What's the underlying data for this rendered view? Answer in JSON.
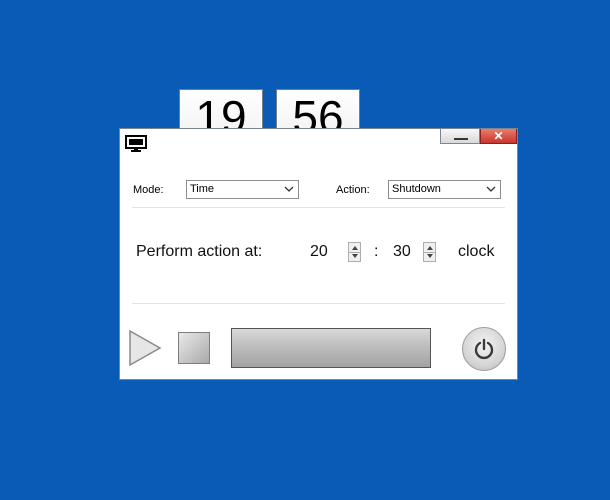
{
  "clock": {
    "hours": "19",
    "minutes": "56"
  },
  "window": {
    "controls": {
      "minimize_icon": "minimize-icon",
      "close_label": "✕"
    }
  },
  "mode": {
    "label": "Mode:",
    "value": "Time"
  },
  "action": {
    "label": "Action:",
    "value": "Shutdown"
  },
  "schedule": {
    "label": "Perform action at:",
    "hour": "20",
    "separator": ":",
    "minute": "30",
    "suffix": "clock"
  },
  "controls": {
    "play_icon": "play-icon",
    "stop_icon": "stop-icon",
    "power_icon": "power-icon"
  },
  "colors": {
    "desktop": "#0a5bb5",
    "close": "#c7372b"
  }
}
